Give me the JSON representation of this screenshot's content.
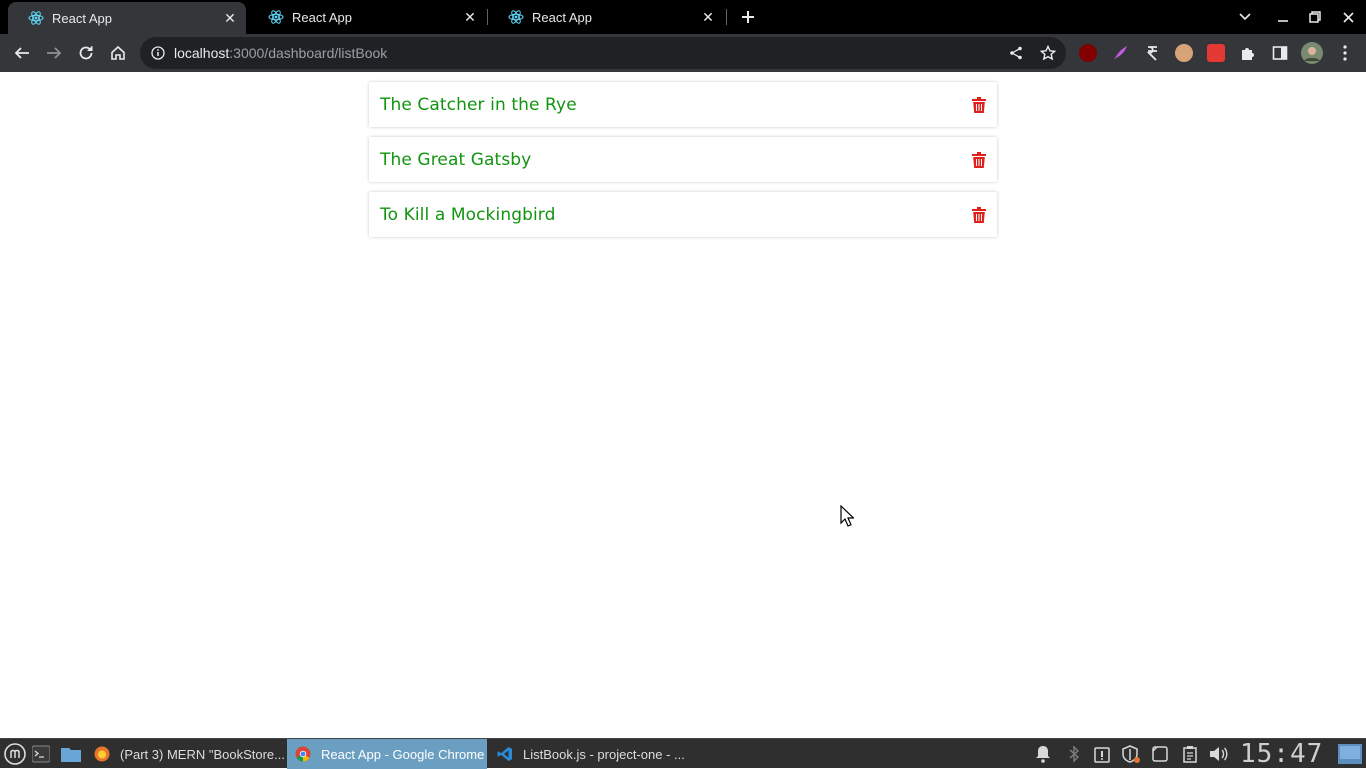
{
  "browser": {
    "tabs": [
      {
        "title": "React App",
        "active": true
      },
      {
        "title": "React App",
        "active": false
      },
      {
        "title": "React App",
        "active": false
      }
    ],
    "url": {
      "host": "localhost",
      "rest": ":3000/dashboard/listBook"
    }
  },
  "books": [
    {
      "title": "The Catcher in the Rye"
    },
    {
      "title": "The Great Gatsby"
    },
    {
      "title": "To Kill a Mockingbird"
    }
  ],
  "colors": {
    "book_title": "#11950f",
    "delete_icon": "#e0201b"
  },
  "taskbar": {
    "items": [
      {
        "label": "(Part 3) MERN \"BookStore..."
      },
      {
        "label": "React App - Google Chrome"
      },
      {
        "label": "ListBook.js - project-one - ..."
      }
    ],
    "clock": "15:47"
  }
}
